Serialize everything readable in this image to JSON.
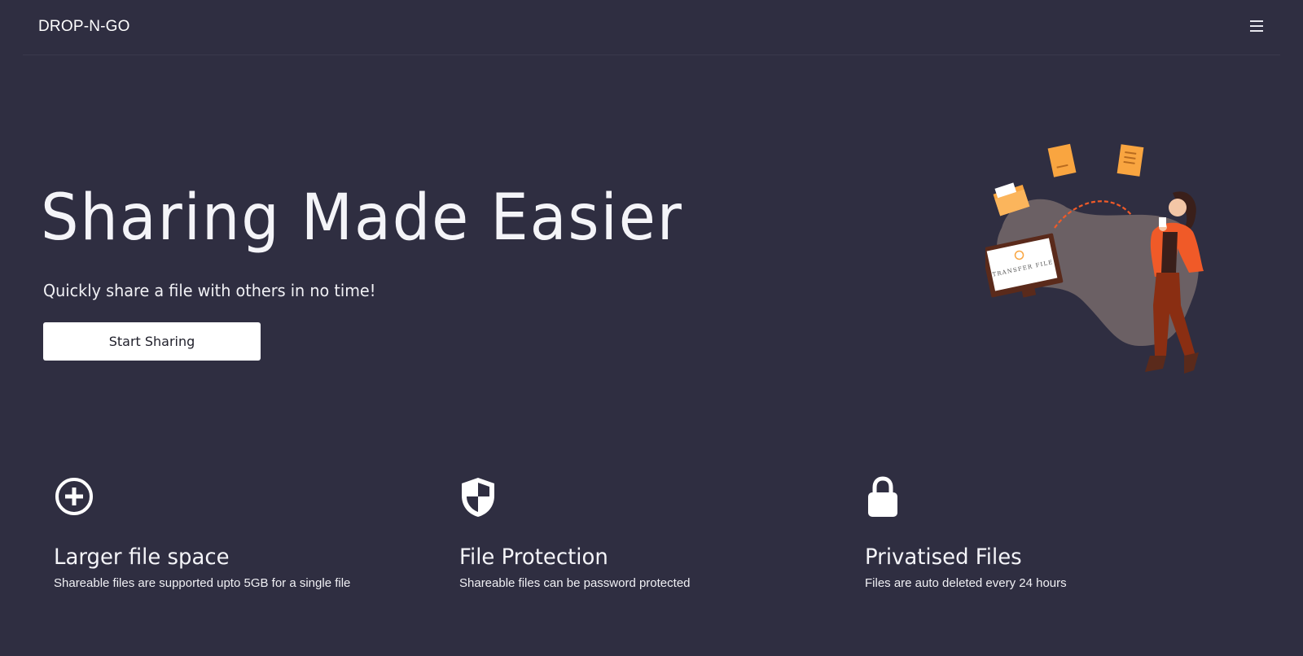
{
  "navbar": {
    "brand": "DROP-N-GO",
    "menu_icon": "hamburger-menu-icon"
  },
  "hero": {
    "title": "Sharing Made Easier",
    "subtitle": "Quickly share a file with others in no time!",
    "cta_label": "Start Sharing",
    "illustration_label": "TRANSFER FILE"
  },
  "features": [
    {
      "icon": "plus-circle-icon",
      "title": "Larger file space",
      "description": "Shareable files are supported upto 5GB for a single file"
    },
    {
      "icon": "shield-icon",
      "title": "File Protection",
      "description": "Shareable files can be password protected"
    },
    {
      "icon": "lock-icon",
      "title": "Privatised Files",
      "description": "Files are auto deleted every 24 hours"
    }
  ],
  "colors": {
    "background": "#2f2e41",
    "text": "#ffffff",
    "button_bg": "#ffffff",
    "accent_orange": "#f9a540",
    "accent_red": "#f05a28"
  }
}
